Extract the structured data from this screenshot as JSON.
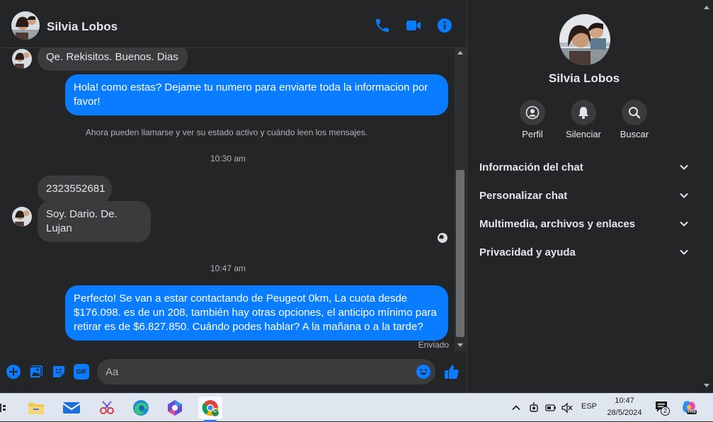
{
  "contact": {
    "name": "Silvia Lobos"
  },
  "messages": {
    "m1": "Qe.  Rekisitos.  Buenos.  Dias",
    "m2": "Hola! como estas? Dejame tu numero para enviarte toda la informacion por favor!",
    "sys1": "Ahora pueden llamarse y ver su estado activo y cuándo leen los mensajes.",
    "time1": "10:30 am",
    "m3": "2323552681",
    "m4": "Soy. Dario. De. Lujan",
    "time2": "10:47 am",
    "m5": "Perfecto!  Se van a estar contactando de Peugeot 0km, La cuota desde $176.098. es de un 208, también hay otras opciones, el anticipo mínimo para retirar es de $6.827.850. Cuándo podes hablar? A la mañana o a la tarde?",
    "status": "Enviado"
  },
  "composer": {
    "placeholder": "Aa",
    "gif_label": "GIF"
  },
  "sidebar": {
    "actions": {
      "profile": "Perfil",
      "mute": "Silenciar",
      "search": "Buscar"
    },
    "sections": {
      "chat_info": "Información del chat",
      "customize": "Personalizar chat",
      "media": "Multimedia, archivos y enlaces",
      "privacy": "Privacidad y ayuda"
    }
  },
  "taskbar": {
    "language": "ESP",
    "time": "10:47",
    "date": "28/5/2024",
    "notifications": "2",
    "chrome_badge": "C",
    "copilot_badge": "PRE"
  },
  "colors": {
    "background": "#242526",
    "incoming_bubble": "#3a3b3c",
    "outgoing_bubble": "#0a7cff",
    "accent": "#0a7cff",
    "taskbar": "#dfe6ef"
  },
  "icons": {
    "header": [
      "phone-icon",
      "video-camera-icon",
      "info-icon"
    ],
    "composer": [
      "plus-icon",
      "image-icon",
      "sticker-icon",
      "gif-icon",
      "emoji-icon",
      "thumbs-up-icon"
    ],
    "sidebar": [
      "profile-icon",
      "bell-icon",
      "search-icon",
      "chevron-down-icon"
    ]
  }
}
